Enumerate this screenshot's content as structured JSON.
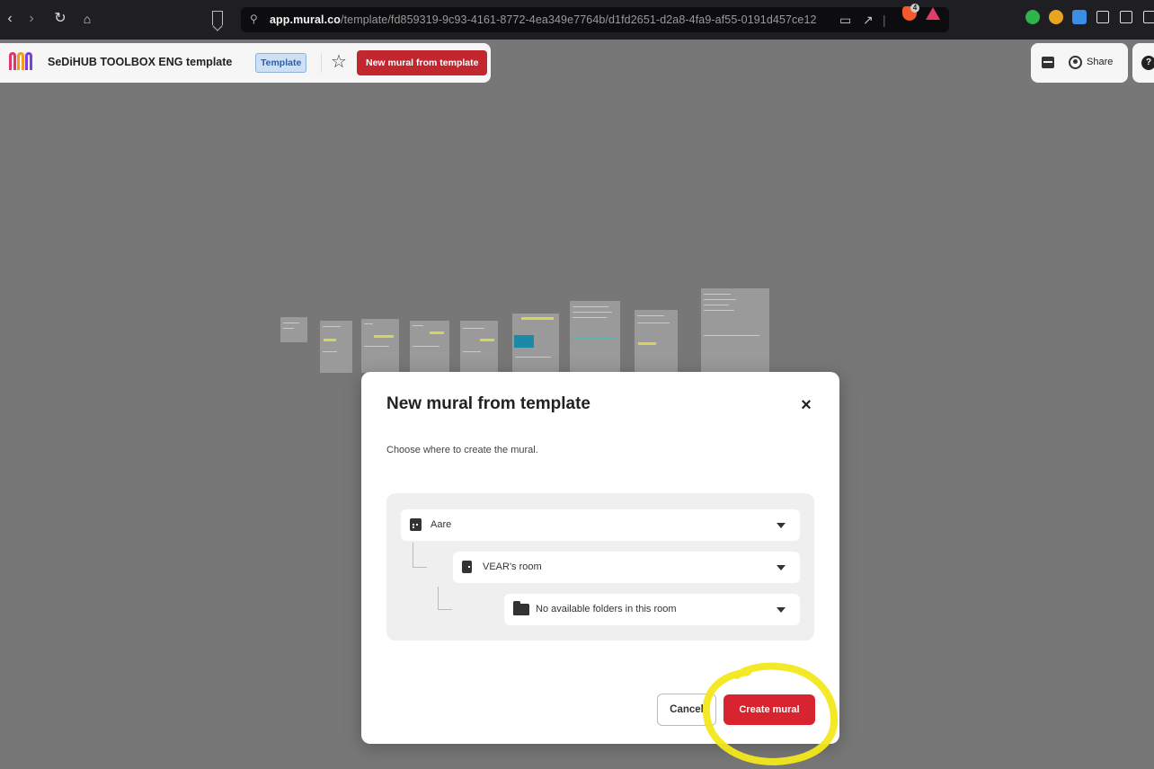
{
  "browser": {
    "url_host": "app.mural.co",
    "url_path": "/template/fd859319-9c93-4161-8772-4ea349e7764b/d1fd2651-d2a8-4fa9-af55-0191d457ce12",
    "brave_badge": "4"
  },
  "toolbar": {
    "title": "SeDiHUB TOOLBOX ENG template",
    "template_badge": "Template",
    "new_mural_label": "New mural from template",
    "share_label": "Share"
  },
  "modal": {
    "title": "New mural from template",
    "close_symbol": "×",
    "description": "Choose where to create the mural.",
    "workspace": {
      "label": "Aare",
      "icon": "building-icon"
    },
    "room": {
      "label": "VEAR's room",
      "icon": "door-icon"
    },
    "folder": {
      "label": "No available folders in this room",
      "icon": "folder-icon"
    },
    "cancel_label": "Cancel",
    "create_label": "Create mural"
  },
  "colors": {
    "primary_red": "#d8242e",
    "annotation_yellow": "#f3e81a",
    "template_badge_blue": "#cfe0f5"
  }
}
